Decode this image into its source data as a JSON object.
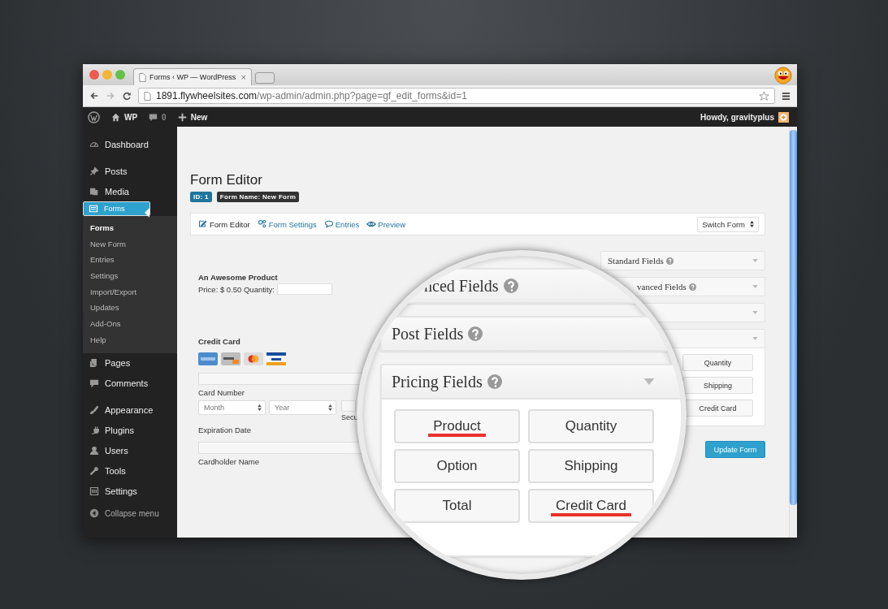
{
  "browser": {
    "tab_title": "Forms ‹ WP — WordPress",
    "tab_close": "×",
    "url_host": "1891.flywheelsites.com",
    "url_path": "/wp-admin/admin.php?page=gf_edit_forms&id=1"
  },
  "admin_bar": {
    "site": "WP",
    "comments_count": "0",
    "new_label": "New",
    "greeting": "Howdy, gravityplus"
  },
  "sidebar": {
    "items": [
      {
        "label": "Dashboard",
        "selected": false,
        "gap_before": false
      },
      {
        "label": "Posts",
        "selected": false,
        "gap_before": true
      },
      {
        "label": "Media",
        "selected": false,
        "gap_before": false
      },
      {
        "label": "Forms",
        "selected": true,
        "gap_before": false,
        "children": [
          {
            "label": "Forms",
            "selected": true
          },
          {
            "label": "New Form",
            "selected": false
          },
          {
            "label": "Entries",
            "selected": false
          },
          {
            "label": "Settings",
            "selected": false
          },
          {
            "label": "Import/Export",
            "selected": false
          },
          {
            "label": "Updates",
            "selected": false
          },
          {
            "label": "Add-Ons",
            "selected": false
          },
          {
            "label": "Help",
            "selected": false
          }
        ]
      },
      {
        "label": "Pages",
        "selected": false,
        "gap_before": false
      },
      {
        "label": "Comments",
        "selected": false,
        "gap_before": false
      },
      {
        "label": "Appearance",
        "selected": false,
        "gap_before": true
      },
      {
        "label": "Plugins",
        "selected": false,
        "gap_before": false
      },
      {
        "label": "Users",
        "selected": false,
        "gap_before": false
      },
      {
        "label": "Tools",
        "selected": false,
        "gap_before": false
      },
      {
        "label": "Settings",
        "selected": false,
        "gap_before": false
      }
    ],
    "collapse": "Collapse menu"
  },
  "page": {
    "title": "Form Editor",
    "id_badge": "ID: 1",
    "name_badge": "Form Name: New Form"
  },
  "toolbar": {
    "links": [
      {
        "label": "Form Editor",
        "selected": true
      },
      {
        "label": "Form Settings",
        "selected": false
      },
      {
        "label": "Entries",
        "selected": false
      },
      {
        "label": "Preview",
        "selected": false
      }
    ],
    "switch_form": "Switch Form"
  },
  "form_preview": {
    "product_label": "An Awesome Product",
    "price_label": "Price: $ 0.50 Quantity:",
    "credit_card_label": "Credit Card",
    "card_number_label": "Card Number",
    "month_placeholder": "Month",
    "year_placeholder": "Year",
    "expiration_label": "Expiration Date",
    "security_label": "Secu",
    "cardholder_label": "Cardholder Name"
  },
  "field_panels": [
    {
      "title": "Standard Fields",
      "expanded": false
    },
    {
      "title": "vanced Fields",
      "expanded": false
    },
    {
      "expanded": false
    },
    {
      "expanded": true,
      "buttons": [
        "Quantity",
        "Shipping",
        "Credit Card"
      ]
    }
  ],
  "update_button": "Update Form",
  "magnifier": {
    "panels": [
      {
        "title": "nced Fields",
        "expanded": false
      },
      {
        "title": "Post Fields",
        "expanded": false
      },
      {
        "title": "Pricing Fields",
        "expanded": true,
        "buttons": [
          {
            "label": "Product",
            "highlighted": true
          },
          {
            "label": "Quantity",
            "highlighted": false
          },
          {
            "label": "Option",
            "highlighted": false
          },
          {
            "label": "Shipping",
            "highlighted": false
          },
          {
            "label": "Total",
            "highlighted": false
          },
          {
            "label": "Credit Card",
            "highlighted": true
          }
        ]
      }
    ]
  }
}
